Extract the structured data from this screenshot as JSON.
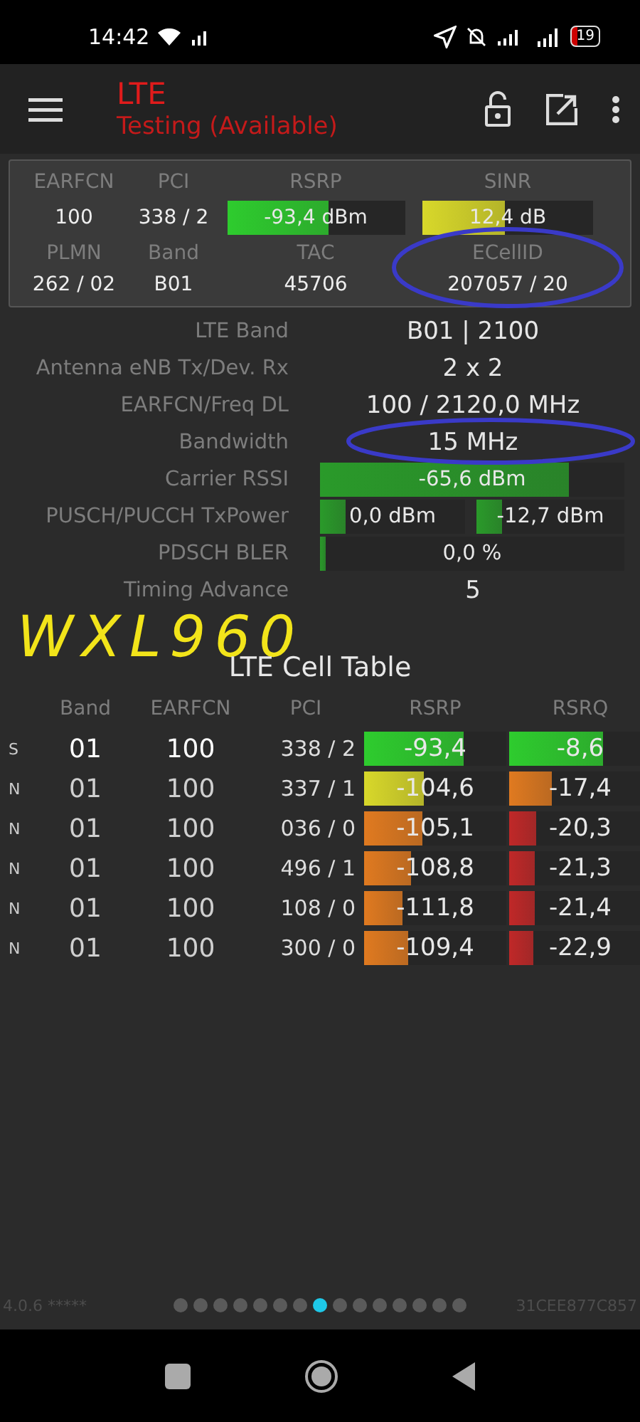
{
  "status_bar": {
    "time": "14:42",
    "battery": "19"
  },
  "toolbar": {
    "title": "LTE",
    "subtitle": "Testing (Available)"
  },
  "summary": {
    "row1": [
      {
        "label": "EARFCN",
        "value": "100"
      },
      {
        "label": "PCI",
        "value": "338 / 2"
      },
      {
        "label": "RSRP",
        "value": "-93,4 dBm",
        "level": 0.57,
        "color": "#2ecc2e"
      },
      {
        "label": "SINR",
        "value": "12,4 dB",
        "level": 0.48,
        "color": "#d8d82a"
      }
    ],
    "row2": [
      {
        "label": "PLMN",
        "value": "262 / 02"
      },
      {
        "label": "Band",
        "value": "B01"
      },
      {
        "label": "TAC",
        "value": "45706"
      },
      {
        "label": "ECellID",
        "value": "207057 / 20"
      }
    ]
  },
  "details": [
    {
      "kind": "text",
      "label": "LTE Band",
      "value": "B01 | 2100"
    },
    {
      "kind": "text",
      "label": "Antenna eNB Tx/Dev. Rx",
      "value": "2 x 2"
    },
    {
      "kind": "text",
      "label": "EARFCN/Freq DL",
      "value": "100 / 2120,0 MHz"
    },
    {
      "kind": "text",
      "label": "Bandwidth",
      "value": "15 MHz"
    },
    {
      "kind": "bar",
      "label": "Carrier RSSI",
      "bars": [
        {
          "value": "-65,6 dBm",
          "level": 0.82
        }
      ]
    },
    {
      "kind": "bar",
      "label": "PUSCH/PUCCH TxPower",
      "bars": [
        {
          "value": "0,0 dBm",
          "level": 0.18
        },
        {
          "value": "-12,7 dBm",
          "level": 0.17
        }
      ]
    },
    {
      "kind": "bar",
      "label": "PDSCH BLER",
      "bars": [
        {
          "value": "0,0 %",
          "level": 0.02
        }
      ]
    },
    {
      "kind": "text",
      "label": "Timing Advance",
      "value": "5"
    }
  ],
  "annotations": {
    "handwriting": "WXL960"
  },
  "cell_table": {
    "title": "LTE Cell Table",
    "columns": [
      "Band",
      "EARFCN",
      "PCI",
      "RSRP",
      "RSRQ"
    ],
    "rows": [
      {
        "type": "S",
        "band": "01",
        "earfcn": "100",
        "pci": "338 / 2",
        "rsrp": {
          "value": "-93,4",
          "level": 0.7,
          "color": "#2ecc2e"
        },
        "rsrq": {
          "value": "-8,6",
          "level": 0.66,
          "color": "#2ecc2e"
        }
      },
      {
        "type": "N",
        "band": "01",
        "earfcn": "100",
        "pci": "337 / 1",
        "rsrp": {
          "value": "-104,6",
          "level": 0.42,
          "color": "#d8d82a"
        },
        "rsrq": {
          "value": "-17,4",
          "level": 0.3,
          "color": "#e07a20"
        }
      },
      {
        "type": "N",
        "band": "01",
        "earfcn": "100",
        "pci": "036 / 0",
        "rsrp": {
          "value": "-105,1",
          "level": 0.41,
          "color": "#e07a20"
        },
        "rsrq": {
          "value": "-20,3",
          "level": 0.19,
          "color": "#c02828"
        }
      },
      {
        "type": "N",
        "band": "01",
        "earfcn": "100",
        "pci": "496 / 1",
        "rsrp": {
          "value": "-108,8",
          "level": 0.33,
          "color": "#e07a20"
        },
        "rsrq": {
          "value": "-21,3",
          "level": 0.18,
          "color": "#c02828"
        }
      },
      {
        "type": "N",
        "band": "01",
        "earfcn": "100",
        "pci": "108 / 0",
        "rsrp": {
          "value": "-111,8",
          "level": 0.27,
          "color": "#e07a20"
        },
        "rsrq": {
          "value": "-21,4",
          "level": 0.18,
          "color": "#c02828"
        }
      },
      {
        "type": "N",
        "band": "01",
        "earfcn": "100",
        "pci": "300 / 0",
        "rsrp": {
          "value": "-109,4",
          "level": 0.31,
          "color": "#e07a20"
        },
        "rsrq": {
          "value": "-22,9",
          "level": 0.17,
          "color": "#c02828"
        }
      }
    ]
  },
  "footer": {
    "version": "4.0.6 *****",
    "id": "31CEE877C857",
    "pages": [
      {
        "selected": false
      },
      {
        "selected": false
      },
      {
        "selected": false
      },
      {
        "selected": false
      },
      {
        "selected": false
      },
      {
        "selected": false
      },
      {
        "selected": false
      },
      {
        "selected": true
      },
      {
        "selected": false
      },
      {
        "selected": false
      },
      {
        "selected": false
      },
      {
        "selected": false
      },
      {
        "selected": false
      },
      {
        "selected": false
      },
      {
        "selected": false
      }
    ]
  }
}
